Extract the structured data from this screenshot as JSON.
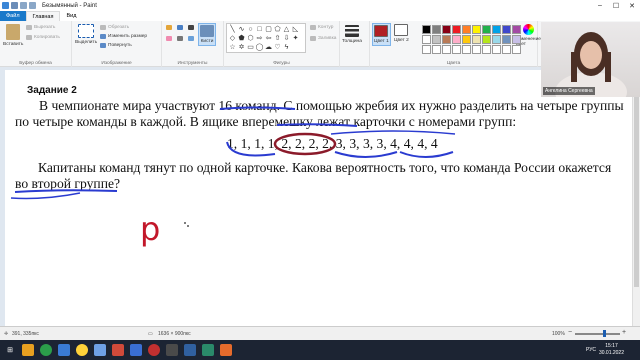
{
  "window": {
    "title": "Безымянный - Paint"
  },
  "tabs": [
    {
      "label": "Файл"
    },
    {
      "label": "Главная"
    },
    {
      "label": "Вид"
    }
  ],
  "ribbon": {
    "clipboard": {
      "paste": "Вставить",
      "cut": "Вырезать",
      "copy": "Копировать",
      "group": "Буфер обмена"
    },
    "image": {
      "select": "Выделить",
      "crop": "Обрезать",
      "resize": "Изменить размер",
      "rotate": "Повернуть",
      "group": "Изображение"
    },
    "tools": {
      "brushes": "Кисти",
      "group": "Инструменты"
    },
    "shapes": {
      "outline": "Контур",
      "fill": "Заливка",
      "size": "Толщина",
      "group": "Фигуры"
    },
    "colors": {
      "color1": "Цвет 1",
      "color2": "Цвет 2",
      "edit": "Изменение цвет",
      "group": "Цвета"
    },
    "palette": [
      "#000000",
      "#7f7f7f",
      "#880015",
      "#ed1c24",
      "#ff7f27",
      "#fff200",
      "#22b14c",
      "#00a2e8",
      "#3f48cc",
      "#a349a4",
      "#ffffff",
      "#c3c3c3",
      "#b97a57",
      "#ffaec9",
      "#ffc90e",
      "#efe4b0",
      "#b5e61d",
      "#99d9ea",
      "#7092be",
      "#c8bfe7",
      "#ffffff",
      "#ffffff",
      "#ffffff",
      "#ffffff",
      "#ffffff",
      "#ffffff",
      "#ffffff",
      "#ffffff",
      "#ffffff",
      "#ffffff"
    ],
    "color1_value": "#b01f24"
  },
  "document": {
    "task_title": "Задание 2",
    "line1": "В чемпионате мира участвуют 16 команд. С помощью жребия их нужно разделить на четыре группы",
    "line2": "по четыре команды в каждой. В ящике вперемешку лежат карточки с номерами групп:",
    "cards": "1, 1, 1, 1, 2, 2, 2, 2, 3, 3, 3, 3, 4, 4, 4, 4",
    "line3": "Капитаны команд тянут по одной карточке. Какова вероятность того, что команда России окажется",
    "line4": "во второй группе?",
    "handwritten": "p"
  },
  "webcam": {
    "caption": "Ангелина Сергеевна"
  },
  "status": {
    "cursor": "391, 335пкс",
    "canvas_size": "1636 × 900пкс",
    "zoom": "100%"
  },
  "taskbar": {
    "lang": "РУС",
    "time": "15:17",
    "date": "30.01.2022"
  }
}
